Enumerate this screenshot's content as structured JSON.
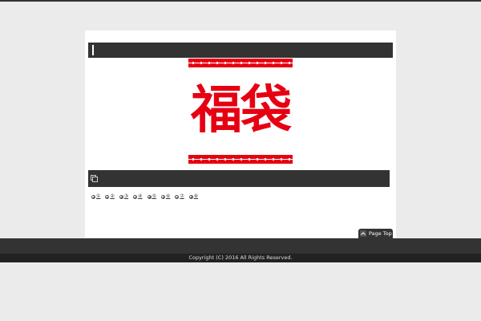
{
  "banner": {
    "text": "福袋"
  },
  "nav": {
    "items": [
      {
        "label": "①"
      },
      {
        "label": "②"
      },
      {
        "label": "③"
      },
      {
        "label": "④"
      },
      {
        "label": "⑤"
      },
      {
        "label": "⑥"
      },
      {
        "label": "⑦"
      },
      {
        "label": "⑧"
      }
    ]
  },
  "pagetop": {
    "label": "Page Top",
    "icon": "chevron-up-icon"
  },
  "section": {
    "icon": "copy-icon"
  },
  "footer": {
    "copyright": "Copyright (C) 2016 All Rights Reserved."
  },
  "colors": {
    "accent_red": "#e60012",
    "bar_dark": "#333333",
    "background": "#ebebeb"
  }
}
